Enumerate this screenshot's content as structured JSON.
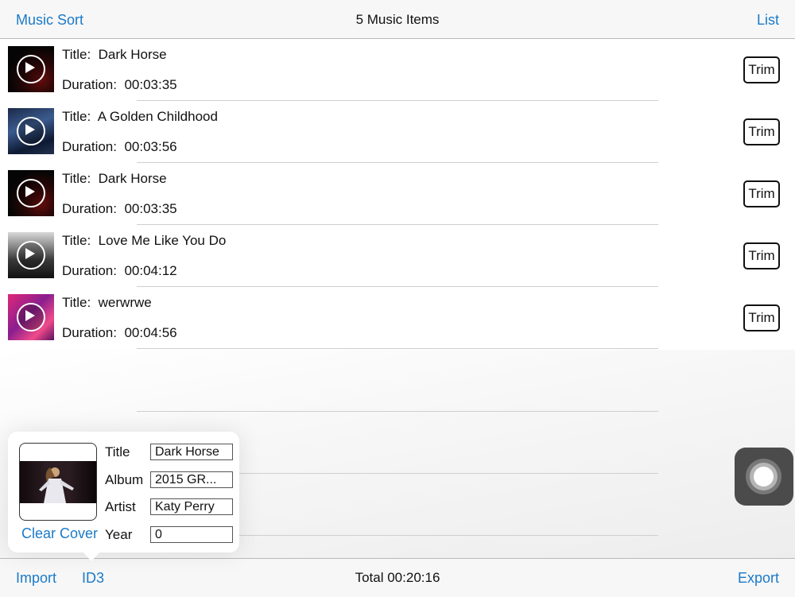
{
  "header": {
    "left_button": "Music Sort",
    "title": "5 Music Items",
    "right_button": "List"
  },
  "labels": {
    "title_prefix": "Title:  ",
    "duration_prefix": "Duration:  ",
    "trim": "Trim"
  },
  "items": [
    {
      "title": "Dark Horse",
      "duration": "00:03:35",
      "art": "dark-red-cover"
    },
    {
      "title": "A Golden Childhood",
      "duration": "00:03:56",
      "art": "blue-night-cover"
    },
    {
      "title": "Dark Horse",
      "duration": "00:03:35",
      "art": "dark-red-cover"
    },
    {
      "title": "Love Me Like You Do",
      "duration": "00:04:12",
      "art": "grayscale-face-cover"
    },
    {
      "title": "werwrwe",
      "duration": "00:04:56",
      "art": "pink-magenta-cover"
    }
  ],
  "id3_panel": {
    "clear_cover": "Clear Cover",
    "title_label": "Title",
    "album_label": "Album",
    "artist_label": "Artist",
    "year_label": "Year",
    "title_value": "Dark Horse",
    "album_value": "2015 GR...",
    "artist_value": "Katy Perry",
    "year_value": "0"
  },
  "toolbar": {
    "import": "Import",
    "id3": "ID3",
    "total": "Total 00:20:16",
    "export": "Export"
  },
  "colors": {
    "accent": "#1b7ac8",
    "bar_background": "#f7f7f7",
    "separator": "#cfcfcf"
  }
}
